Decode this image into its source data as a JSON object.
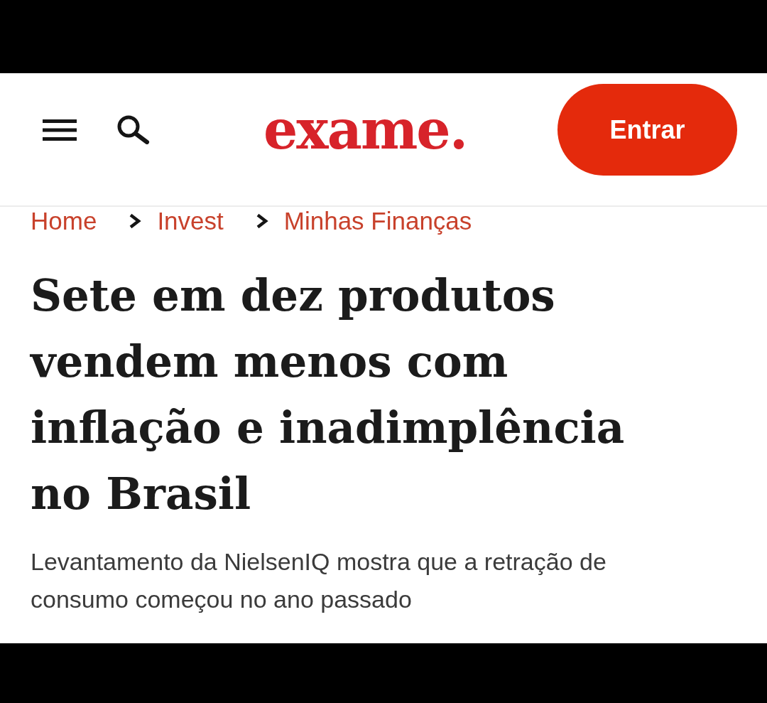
{
  "header": {
    "logo": "exame.",
    "login_button": "Entrar"
  },
  "breadcrumbs": [
    "Home",
    "Invest",
    "Minhas Finanças"
  ],
  "article": {
    "headline": "Sete em dez produtos vendem menos com inflação e inadimplência no Brasil",
    "subtitle": "Levantamento da NielsenIQ mostra que a retração de consumo começou no ano passado"
  }
}
